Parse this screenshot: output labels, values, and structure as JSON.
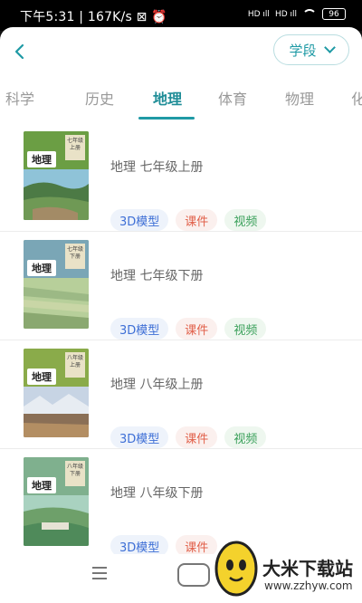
{
  "status": {
    "time": "下午5:31 | 167K/s ⊠ ⏰",
    "signal1": "HD ıll",
    "signal2": "HD ıll",
    "battery": "96"
  },
  "header": {
    "back_icon": "back-chevron-icon",
    "stage_label": "学段"
  },
  "tabs": [
    "科学",
    "历史",
    "地理",
    "体育",
    "物理",
    "化"
  ],
  "active_tab": "地理",
  "books": [
    {
      "title": "地理 七年级上册",
      "cover_title": "地理",
      "cover_grade": "七年级\n上册",
      "tags": [
        "3D模型",
        "课件",
        "视频"
      ]
    },
    {
      "title": "地理 七年级下册",
      "cover_title": "地理",
      "cover_grade": "七年级\n下册",
      "tags": [
        "3D模型",
        "课件",
        "视频"
      ]
    },
    {
      "title": "地理 八年级上册",
      "cover_title": "地理",
      "cover_grade": "八年级\n上册",
      "tags": [
        "3D模型",
        "课件",
        "视频"
      ]
    },
    {
      "title": "地理 八年级下册",
      "cover_title": "地理",
      "cover_grade": "八年级\n下册",
      "tags": [
        "3D模型",
        "课件"
      ]
    }
  ],
  "watermark": {
    "text": "大米下载站",
    "url": "www.zzhyw.com"
  },
  "colors": {
    "accent": "#1f9aa5",
    "tag_3d": "#3e6fd6",
    "tag_ware": "#e1604a",
    "tag_video": "#3aa05a"
  }
}
